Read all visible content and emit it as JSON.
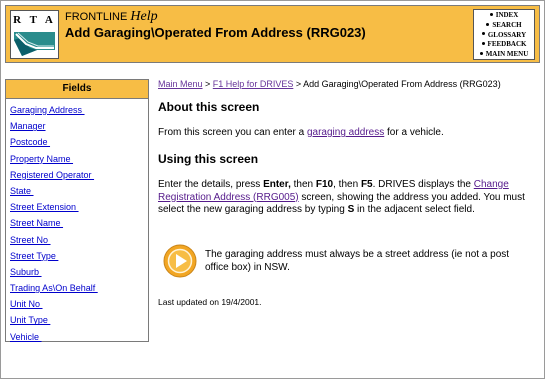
{
  "header": {
    "app": "FRONTLINE",
    "help": "Help",
    "title": "Add Garaging\\Operated From Address (RRG023)",
    "logo_text": "R T A"
  },
  "topnav": [
    "INDEX",
    "SEARCH",
    "GLOSSARY",
    "FEEDBACK",
    "MAIN MENU"
  ],
  "fields": {
    "heading": "Fields",
    "items": [
      "Garaging Address ",
      "Manager",
      "Postcode ",
      "Property Name ",
      "Registered Operator ",
      "State ",
      "Street Extension ",
      "Street Name ",
      "Street No ",
      "Street Type ",
      "Suburb ",
      "Trading As\\On Behalf ",
      "Unit No ",
      "Unit Type ",
      "Vehicle "
    ]
  },
  "breadcrumb": {
    "main_menu": "Main Menu",
    "sep1": " > ",
    "f1_help": "F1 Help for DRIVES",
    "sep2": " > ",
    "current": "Add Garaging\\Operated From Address (RRG023)"
  },
  "about": {
    "heading": "About this screen",
    "text_before": "From this screen you can enter a ",
    "link": "garaging address",
    "text_after": " for a vehicle."
  },
  "using": {
    "heading": "Using this screen",
    "t1": "Enter the details, press ",
    "k1": "Enter,",
    "t2": " then ",
    "k2": "F10",
    "t3": ", then ",
    "k3": "F5",
    "t4": ". DRIVES displays the ",
    "link": "Change Registration Address (RRG005)",
    "t5": " screen, showing the address you added. You must select the new garaging address by typing ",
    "k4": "S",
    "t6": " in the adjacent select field."
  },
  "note": {
    "icon": "arrow-right-icon",
    "text": "The garaging address must always be a street address (ie not a post office box) in NSW."
  },
  "updated": "Last updated on 19/4/2001.",
  "colors": {
    "accent": "#f7bd45",
    "link": "#0000cc",
    "visited": "#663399"
  }
}
